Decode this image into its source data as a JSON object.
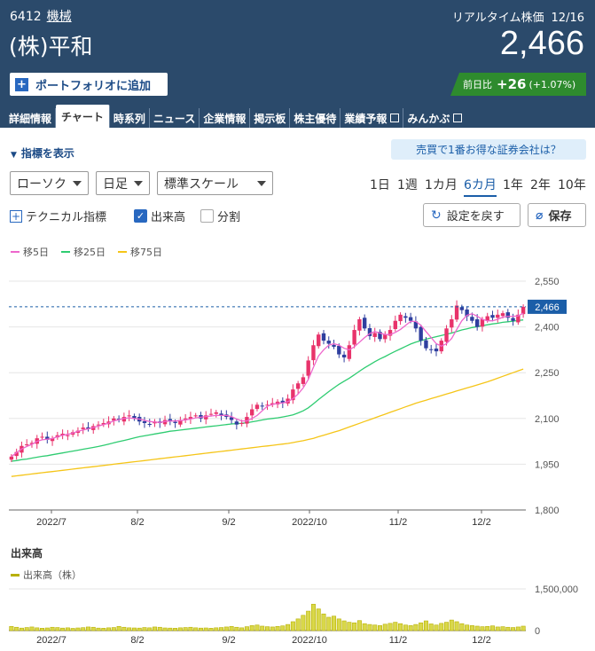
{
  "header": {
    "code": "6412",
    "category": "機械",
    "company": "(株)平和",
    "realtime_label": "リアルタイム株価",
    "date": "12/16",
    "price": "2,466",
    "add_portfolio": "ポートフォリオに追加",
    "change_label": "前日比",
    "change_value": "+26",
    "change_pct": "(+1.07%)"
  },
  "tabs": [
    {
      "label": "詳細情報"
    },
    {
      "label": "チャート",
      "active": true
    },
    {
      "label": "時系列"
    },
    {
      "label": "ニュース"
    },
    {
      "label": "企業情報"
    },
    {
      "label": "掲示板"
    },
    {
      "label": "株主優待"
    },
    {
      "label": "業績予報"
    },
    {
      "label": "みんかぶ"
    }
  ],
  "toolbar": {
    "indicator_toggle": "指標を表示",
    "promo": "売買で1番お得な証券会社は？",
    "chart_type": "ローソク",
    "interval": "日足",
    "scale": "標準スケール",
    "periods": [
      "1日",
      "1週",
      "1カ月",
      "6カ月",
      "1年",
      "2年",
      "10年"
    ],
    "active_period": "6カ月",
    "technical": "テクニカル指標",
    "volume_check": "出来高",
    "split_check": "分割",
    "reset": "設定を戻す",
    "save": "保存"
  },
  "legend": {
    "ma5": "移5日",
    "ma25": "移25日",
    "ma75": "移75日"
  },
  "colors": {
    "header_bg": "#2b4a6b",
    "up": "#e8336b",
    "down": "#2f3f9f",
    "ma5": "#ee66cc",
    "ma25": "#2ecc71",
    "ma75": "#f5c518",
    "volume": "#b8b000",
    "change_bg": "#2e8b2e"
  },
  "volume_section": {
    "title": "出来高",
    "legend": "出来高（株）"
  },
  "chart_data": {
    "type": "candlestick",
    "x_ticks": [
      "2022/7",
      "8/2",
      "9/2",
      "2022/10",
      "11/2",
      "12/2"
    ],
    "y_ticks": [
      "2,550",
      "2,400",
      "2,250",
      "2,100",
      "1,950",
      "1,800"
    ],
    "ylim": [
      1800,
      2550
    ],
    "current_price_label": "2,466",
    "current_price": 2466,
    "close": [
      1975,
      1990,
      2010,
      2015,
      2020,
      2035,
      2040,
      2030,
      2035,
      2045,
      2050,
      2045,
      2055,
      2060,
      2070,
      2065,
      2075,
      2080,
      2085,
      2090,
      2100,
      2095,
      2105,
      2110,
      2100,
      2090,
      2085,
      2080,
      2090,
      2085,
      2095,
      2090,
      2085,
      2095,
      2100,
      2105,
      2110,
      2100,
      2110,
      2115,
      2120,
      2110,
      2105,
      2095,
      2080,
      2085,
      2105,
      2130,
      2145,
      2140,
      2145,
      2150,
      2155,
      2150,
      2165,
      2195,
      2215,
      2235,
      2290,
      2340,
      2375,
      2355,
      2345,
      2335,
      2310,
      2300,
      2340,
      2390,
      2425,
      2395,
      2370,
      2380,
      2360,
      2375,
      2390,
      2420,
      2440,
      2430,
      2420,
      2395,
      2355,
      2330,
      2325,
      2320,
      2355,
      2395,
      2425,
      2470,
      2455,
      2435,
      2420,
      2400,
      2425,
      2435,
      2430,
      2440,
      2445,
      2430,
      2420,
      2440,
      2466
    ],
    "ma5": [
      1975,
      1988,
      2000,
      2008,
      2015,
      2025,
      2030,
      2032,
      2034,
      2040,
      2045,
      2048,
      2052,
      2058,
      2062,
      2066,
      2070,
      2075,
      2080,
      2085,
      2092,
      2096,
      2100,
      2102,
      2100,
      2098,
      2094,
      2090,
      2088,
      2087,
      2090,
      2092,
      2092,
      2093,
      2095,
      2098,
      2102,
      2104,
      2106,
      2108,
      2110,
      2110,
      2110,
      2106,
      2098,
      2092,
      2092,
      2100,
      2110,
      2125,
      2140,
      2146,
      2149,
      2151,
      2155,
      2165,
      2180,
      2200,
      2228,
      2268,
      2305,
      2325,
      2340,
      2345,
      2340,
      2330,
      2325,
      2335,
      2350,
      2365,
      2378,
      2385,
      2380,
      2375,
      2375,
      2382,
      2392,
      2405,
      2418,
      2418,
      2405,
      2385,
      2365,
      2345,
      2337,
      2345,
      2362,
      2392,
      2420,
      2438,
      2443,
      2435,
      2425,
      2420,
      2420,
      2425,
      2432,
      2435,
      2435,
      2436,
      2445
    ],
    "ma25": [
      1960,
      1962,
      1965,
      1967,
      1970,
      1973,
      1976,
      1978,
      1981,
      1984,
      1987,
      1990,
      1993,
      1996,
      1999,
      2002,
      2005,
      2008,
      2012,
      2016,
      2020,
      2024,
      2028,
      2032,
      2036,
      2040,
      2043,
      2046,
      2049,
      2052,
      2055,
      2058,
      2060,
      2062,
      2064,
      2066,
      2068,
      2070,
      2072,
      2074,
      2076,
      2078,
      2080,
      2082,
      2083,
      2084,
      2086,
      2089,
      2092,
      2095,
      2098,
      2100,
      2102,
      2105,
      2108,
      2112,
      2118,
      2125,
      2135,
      2148,
      2162,
      2175,
      2188,
      2200,
      2212,
      2222,
      2232,
      2243,
      2255,
      2266,
      2276,
      2286,
      2295,
      2303,
      2312,
      2320,
      2328,
      2336,
      2344,
      2350,
      2355,
      2360,
      2364,
      2368,
      2372,
      2376,
      2380,
      2385,
      2390,
      2394,
      2398,
      2401,
      2404,
      2407,
      2410,
      2412,
      2415,
      2417,
      2419,
      2421,
      2423
    ],
    "ma75": [
      1910,
      1912,
      1914,
      1916,
      1918,
      1920,
      1922,
      1924,
      1926,
      1928,
      1930,
      1932,
      1934,
      1936,
      1938,
      1940,
      1942,
      1944,
      1946,
      1948,
      1950,
      1952,
      1954,
      1956,
      1958,
      1960,
      1962,
      1964,
      1966,
      1968,
      1970,
      1972,
      1974,
      1976,
      1978,
      1980,
      1982,
      1984,
      1986,
      1988,
      1990,
      1992,
      1994,
      1996,
      1998,
      2000,
      2002,
      2004,
      2006,
      2008,
      2010,
      2012,
      2014,
      2016,
      2018,
      2021,
      2024,
      2027,
      2031,
      2035,
      2040,
      2045,
      2050,
      2055,
      2060,
      2066,
      2072,
      2078,
      2084,
      2090,
      2096,
      2102,
      2108,
      2114,
      2120,
      2126,
      2132,
      2138,
      2144,
      2150,
      2155,
      2160,
      2165,
      2170,
      2175,
      2180,
      2185,
      2190,
      2195,
      2200,
      2205,
      2210,
      2215,
      2220,
      2226,
      2232,
      2238,
      2244,
      2250,
      2256,
      2262
    ],
    "volume": {
      "ylim": [
        0,
        1500000
      ],
      "y_ticks": [
        "1,500,000",
        "0"
      ],
      "values": [
        150000,
        120000,
        90000,
        110000,
        130000,
        100000,
        85000,
        95000,
        120000,
        110000,
        90000,
        100000,
        80000,
        95000,
        105000,
        130000,
        120000,
        90000,
        85000,
        100000,
        110000,
        150000,
        120000,
        100000,
        95000,
        90000,
        110000,
        100000,
        130000,
        120000,
        95000,
        90000,
        85000,
        100000,
        110000,
        120000,
        100000,
        90000,
        95000,
        85000,
        100000,
        110000,
        130000,
        150000,
        120000,
        100000,
        140000,
        180000,
        200000,
        160000,
        140000,
        130000,
        150000,
        170000,
        220000,
        320000,
        420000,
        550000,
        700000,
        950000,
        780000,
        600000,
        480000,
        520000,
        420000,
        350000,
        300000,
        280000,
        360000,
        250000,
        220000,
        200000,
        180000,
        230000,
        260000,
        300000,
        250000,
        200000,
        180000,
        220000,
        280000,
        350000,
        240000,
        200000,
        260000,
        300000,
        380000,
        320000,
        250000,
        200000,
        180000,
        160000,
        140000,
        150000,
        170000,
        130000,
        140000,
        120000,
        110000,
        130000,
        160000
      ]
    }
  }
}
